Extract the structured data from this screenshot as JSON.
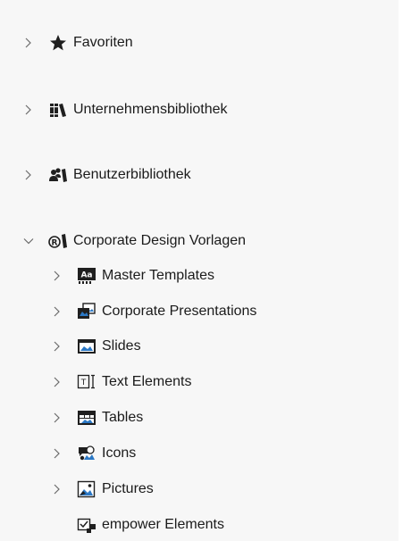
{
  "tree": {
    "root_items": [
      {
        "label": "Favoriten",
        "icon": "star-icon",
        "expanded": false
      },
      {
        "label": "Unternehmensbibliothek",
        "icon": "books-icon",
        "expanded": false
      },
      {
        "label": "Benutzerbibliothek",
        "icon": "users-library-icon",
        "expanded": false
      },
      {
        "label": "Corporate Design Vorlagen",
        "icon": "registered-library-icon",
        "expanded": true
      }
    ],
    "children": [
      {
        "label": "Master Templates",
        "icon": "master-templates-icon"
      },
      {
        "label": "Corporate Presentations",
        "icon": "presentation-icon"
      },
      {
        "label": "Slides",
        "icon": "slides-icon"
      },
      {
        "label": "Text Elements",
        "icon": "text-elements-icon"
      },
      {
        "label": "Tables",
        "icon": "tables-icon"
      },
      {
        "label": "Icons",
        "icon": "icons-icon"
      },
      {
        "label": "Pictures",
        "icon": "pictures-icon"
      },
      {
        "label": "empower Elements",
        "icon": "empower-elements-icon"
      }
    ]
  },
  "colors": {
    "panel_background": "#f7f7f7",
    "text": "#1b1b1b",
    "chevron": "#6b6b6b",
    "icon_dark": "#1f1f1f",
    "icon_blue": "#2b78c5"
  }
}
